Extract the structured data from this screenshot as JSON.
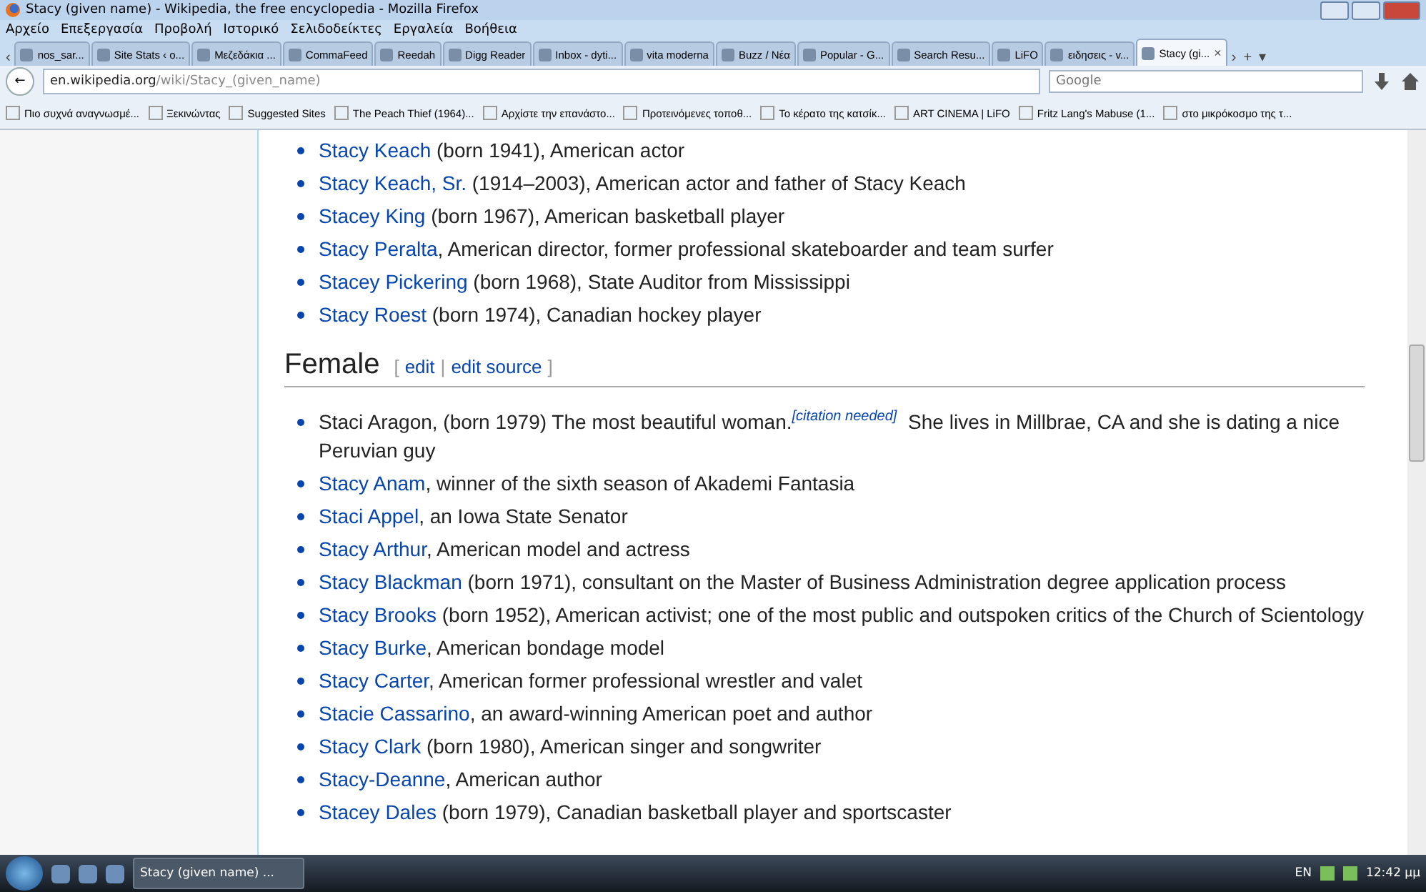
{
  "window": {
    "title": "Stacy (given name) - Wikipedia, the free encyclopedia - Mozilla Firefox"
  },
  "menu": [
    "Αρχείο",
    "Επεξεργασία",
    "Προβολή",
    "Ιστορικό",
    "Σελιδοδείκτες",
    "Εργαλεία",
    "Βοήθεια"
  ],
  "tabs": [
    {
      "label": "nos_sar...",
      "selected": false
    },
    {
      "label": "Site Stats ‹ o...",
      "selected": false
    },
    {
      "label": "Μεζεδάκια ...",
      "selected": false
    },
    {
      "label": "CommaFeed",
      "selected": false
    },
    {
      "label": "Reedah",
      "selected": false
    },
    {
      "label": "Digg Reader",
      "selected": false
    },
    {
      "label": "Inbox - dyti...",
      "selected": false
    },
    {
      "label": "vita moderna",
      "selected": false
    },
    {
      "label": "Buzz / Νέα",
      "selected": false
    },
    {
      "label": "Popular - G...",
      "selected": false
    },
    {
      "label": "Search Resu...",
      "selected": false
    },
    {
      "label": "LiFO",
      "selected": false
    },
    {
      "label": "ειδησεις - v...",
      "selected": false
    },
    {
      "label": "Stacy (gi...",
      "selected": true
    }
  ],
  "tab_scroll_left": "‹",
  "tab_close": "×",
  "tab_scroll_right": "›",
  "new_tab": "+",
  "tab_list": "▾",
  "back": "←",
  "address": {
    "domain": "en.wikipedia.org",
    "path": "/wiki/Stacy_(given_name)"
  },
  "search": {
    "placeholder": "Google"
  },
  "bookmarks": [
    "Πιο συχνά αναγνωσμέ...",
    "Ξεκινώντας",
    "Suggested Sites",
    "The Peach Thief (1964)...",
    "Αρχίστε την επανάστο...",
    "Προτεινόμενες τοποθ...",
    "Το κέρατο της κατσίκ...",
    "ART CINEMA | LiFO",
    "Fritz Lang's Mabuse (1...",
    "στο μικρόκοσμο της τ..."
  ],
  "male_list": [
    {
      "link": "Stacy Keach",
      "text": " (born 1941), American actor"
    },
    {
      "link": "Stacy Keach, Sr.",
      "text": " (1914–2003), American actor and father of Stacy Keach"
    },
    {
      "link": "Stacey King",
      "text": " (born 1967), American basketball player"
    },
    {
      "link": "Stacy Peralta",
      "text": ", American director, former professional skateboarder and team surfer"
    },
    {
      "link": "Stacey Pickering",
      "text": " (born 1968), State Auditor from Mississippi"
    },
    {
      "link": "Stacy Roest",
      "text": " (born 1974), Canadian hockey player"
    }
  ],
  "section": {
    "heading": "Female",
    "open_bracket": "[",
    "edit": "edit",
    "separator": "|",
    "edit_source": "edit source",
    "close_bracket": "]"
  },
  "female_list": [
    {
      "text": "Staci Aragon, (born 1979) The most beautiful woman.",
      "citation": "[citation needed]",
      "text_after": " She lives in Millbrae, CA and she is dating a nice Peruvian guy"
    },
    {
      "link": "Stacy Anam",
      "text": ", winner of the sixth season of Akademi Fantasia"
    },
    {
      "link": "Staci Appel",
      "text": ", an Iowa State Senator"
    },
    {
      "link": "Stacy Arthur",
      "text": ", American model and actress"
    },
    {
      "link": "Stacy Blackman",
      "text": " (born 1971), consultant on the Master of Business Administration degree application process"
    },
    {
      "link": "Stacy Brooks",
      "text": " (born 1952), American activist; one of the most public and outspoken critics of the Church of Scientology"
    },
    {
      "link": "Stacy Burke",
      "text": ", American bondage model"
    },
    {
      "link": "Stacy Carter",
      "text": ", American former professional wrestler and valet"
    },
    {
      "link": "Stacie Cassarino",
      "text": ", an award-winning American poet and author"
    },
    {
      "link": "Stacy Clark",
      "text": " (born 1980), American singer and songwriter"
    },
    {
      "link": "Stacy-Deanne",
      "text": ", American author"
    },
    {
      "link": "Stacey Dales",
      "text": " (born 1979), Canadian basketball player and sportscaster"
    }
  ],
  "taskbar": {
    "window": "Stacy (given name) ...",
    "language": "EN",
    "clock": "12:42 μμ"
  }
}
